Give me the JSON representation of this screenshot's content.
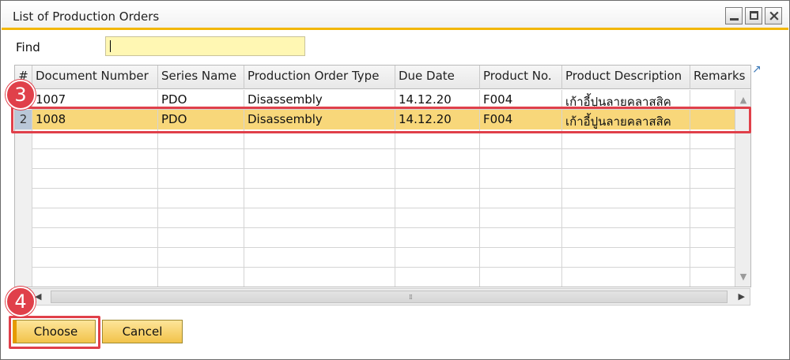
{
  "window": {
    "title": "List of Production Orders",
    "controls": {
      "minimize": "minimize",
      "maximize": "maximize",
      "close": "×"
    }
  },
  "find": {
    "label": "Find",
    "value": "",
    "placeholder": ""
  },
  "table": {
    "columns": [
      {
        "key": "num",
        "label": "#"
      },
      {
        "key": "document_number",
        "label": "Document Number"
      },
      {
        "key": "series_name",
        "label": "Series Name"
      },
      {
        "key": "production_order_type",
        "label": "Production Order Type"
      },
      {
        "key": "due_date",
        "label": "Due Date"
      },
      {
        "key": "product_no",
        "label": "Product No."
      },
      {
        "key": "product_description",
        "label": "Product Description"
      },
      {
        "key": "remarks",
        "label": "Remarks"
      }
    ],
    "rows": [
      {
        "num": "1",
        "document_number": "1007",
        "series_name": "PDO",
        "production_order_type": "Disassembly",
        "due_date": "14.12.20",
        "product_no": "F004",
        "product_description": "เก้าอี้ปูนลายคลาสสิค",
        "remarks": ""
      },
      {
        "num": "2",
        "document_number": "1008",
        "series_name": "PDO",
        "production_order_type": "Disassembly",
        "due_date": "14.12.20",
        "product_no": "F004",
        "product_description": "เก้าอี้ปูนลายคลาสสิค",
        "remarks": ""
      }
    ],
    "selected_row": 2
  },
  "buttons": {
    "choose": "Choose",
    "cancel": "Cancel"
  },
  "annotations": {
    "row_badge": "3",
    "button_badge": "4"
  },
  "icons": {
    "expand": "expand-arrow-icon",
    "scroll_up": "scroll-up-icon",
    "scroll_down": "scroll-down-icon",
    "scroll_left": "scroll-left-icon",
    "scroll_right": "scroll-right-icon"
  },
  "colors": {
    "accent": "#f2b705",
    "selection": "#f8d77a",
    "highlight": "#e0404a",
    "find_bg": "#fff7b3"
  }
}
